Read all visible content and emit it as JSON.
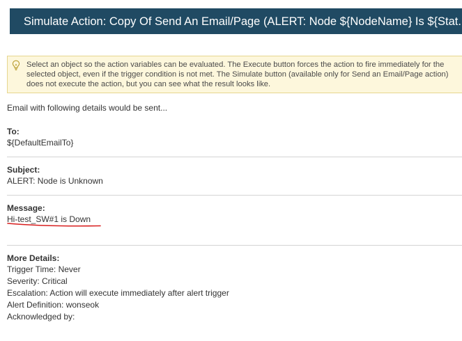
{
  "window": {
    "title": "Simulate Action: Copy Of Send An Email/Page (ALERT: Node ${NodeName} Is ${Stat...$"
  },
  "info": {
    "icon": "lightbulb-icon",
    "line1": "Select an object so the action variables can be evaluated. The Execute button forces the action to fire immediately for the",
    "line2": "selected object, even if the trigger condition is not met. The Simulate button (available only for Send an Email/Page action)",
    "line3": "does not execute the action, but you can see what the result looks like."
  },
  "intro": "Email with following details would be sent...",
  "email": {
    "to_label": "To:",
    "to_value": "${DefaultEmailTo}",
    "subject_label": "Subject:",
    "subject_value": "ALERT: Node is Unknown",
    "message_label": "Message:",
    "message_value": "Hi-test_SW#1 is Down"
  },
  "details": {
    "label": "More Details:",
    "trigger_time": "Trigger Time: Never",
    "severity": "Severity: Critical",
    "escalation": "Escalation: Action will execute immediately after alert trigger",
    "alert_definition": "Alert Definition: wonseok",
    "acknowledged_by": "Acknowledged by:"
  },
  "colors": {
    "title_bar": "#204a63",
    "info_background": "#fdf7dc",
    "info_border": "#e6d68f",
    "annotation_underline": "#d81e1e"
  }
}
